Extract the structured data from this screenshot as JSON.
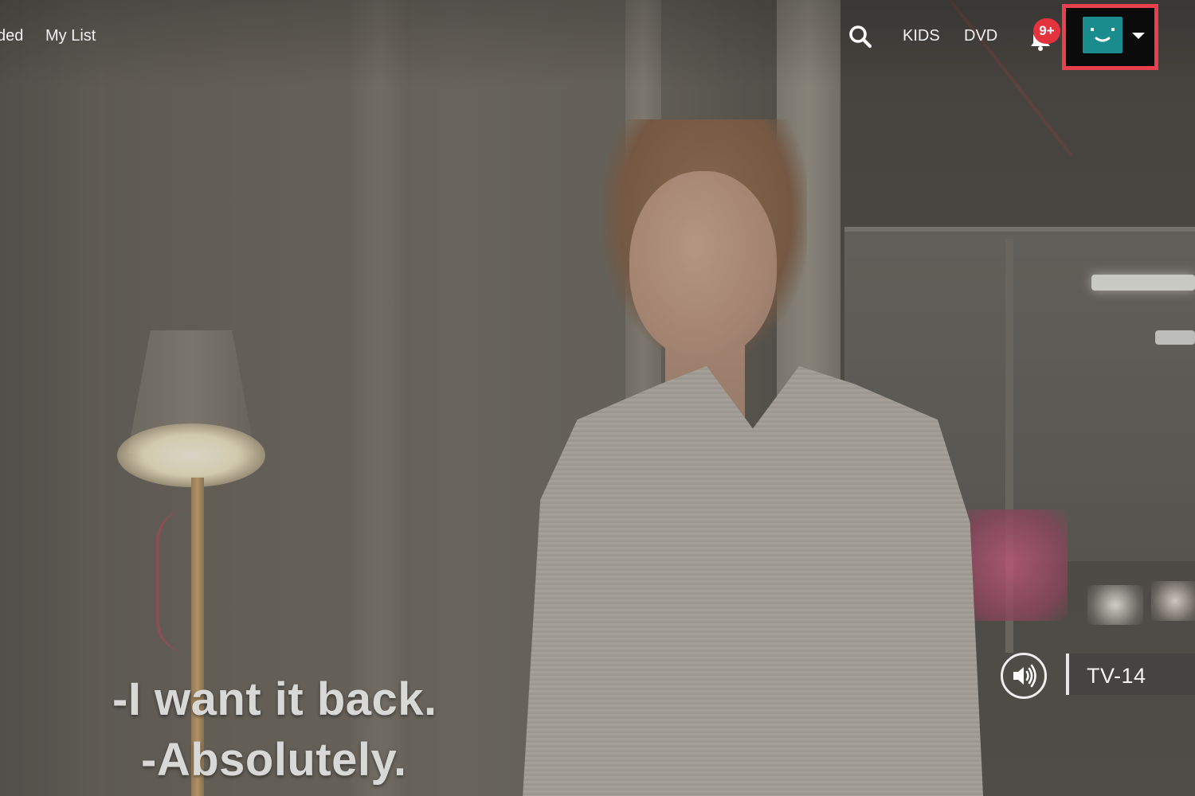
{
  "navigation": {
    "partial_label": "ded",
    "my_list_label": "My List",
    "kids_label": "KIDS",
    "dvd_label": "DVD"
  },
  "notifications": {
    "badge_text": "9+"
  },
  "profile": {
    "avatar_color": "#1b8c8d",
    "highlight_color": "#e9414b"
  },
  "subtitles": {
    "line1": "-I want it back.",
    "line2": "-Absolutely."
  },
  "player": {
    "maturity_rating": "TV-14"
  },
  "icons": {
    "search": "search-icon",
    "bell": "bell-icon",
    "volume": "volume-icon",
    "caret": "caret-down-icon"
  }
}
